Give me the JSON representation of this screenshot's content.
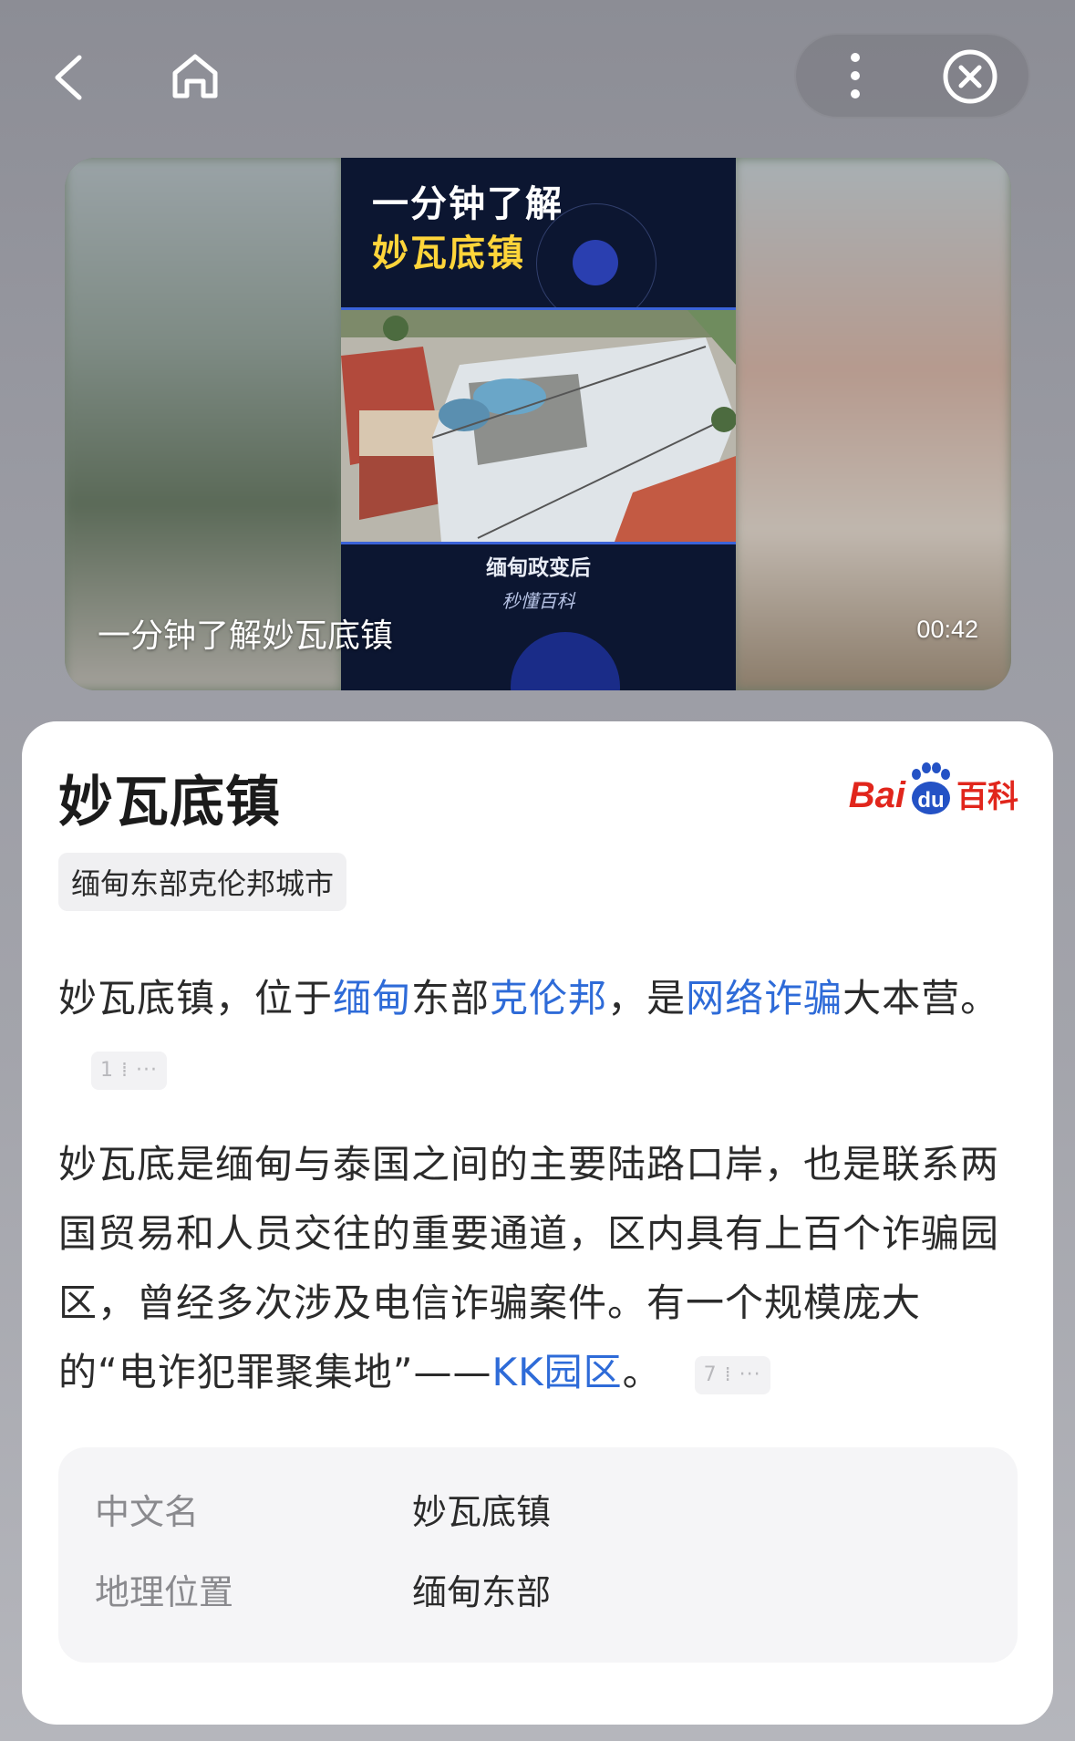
{
  "nav": {
    "back_icon": "chevron-left-icon",
    "home_icon": "home-icon",
    "more_icon": "more-vertical-icon",
    "close_icon": "close-circle-icon"
  },
  "video": {
    "frame_title_line1": "一分钟了解",
    "frame_title_line2": "妙瓦底镇",
    "frame_caption": "缅甸政变后",
    "frame_logo": "秒懂百科",
    "title": "一分钟了解妙瓦底镇",
    "duration": "00:42"
  },
  "card": {
    "title": "妙瓦底镇",
    "logo_text_left": "Bai",
    "logo_text_paw": "du",
    "logo_text_right": "百科",
    "tag": "缅甸东部克伦邦城市",
    "p1": {
      "t1": "妙瓦底镇，位于",
      "link1": "缅甸",
      "t2": "东部",
      "link2": "克伦邦",
      "t3": "，是",
      "link3": "网络诈骗",
      "t4": "大本营。",
      "cite": "1 ⁞ ···"
    },
    "p2": {
      "t1": "妙瓦底是缅甸与泰国之间的主要陆路口岸，也是联系两国贸易和人员交往的重要通道，区内具有上百个诈骗园区，曾经多次涉及电信诈骗案件。有一个规模庞大的“电诈犯罪聚集地”——",
      "link1": "KK园区",
      "t2": "。",
      "cite": "7 ⁞ ···"
    },
    "info": [
      {
        "key": "中文名",
        "value": "妙瓦底镇"
      },
      {
        "key": "地理位置",
        "value": "缅甸东部"
      }
    ]
  },
  "colors": {
    "link": "#2e6bd8",
    "brand_red": "#e1261c",
    "frame_yellow": "#ffd53a"
  }
}
